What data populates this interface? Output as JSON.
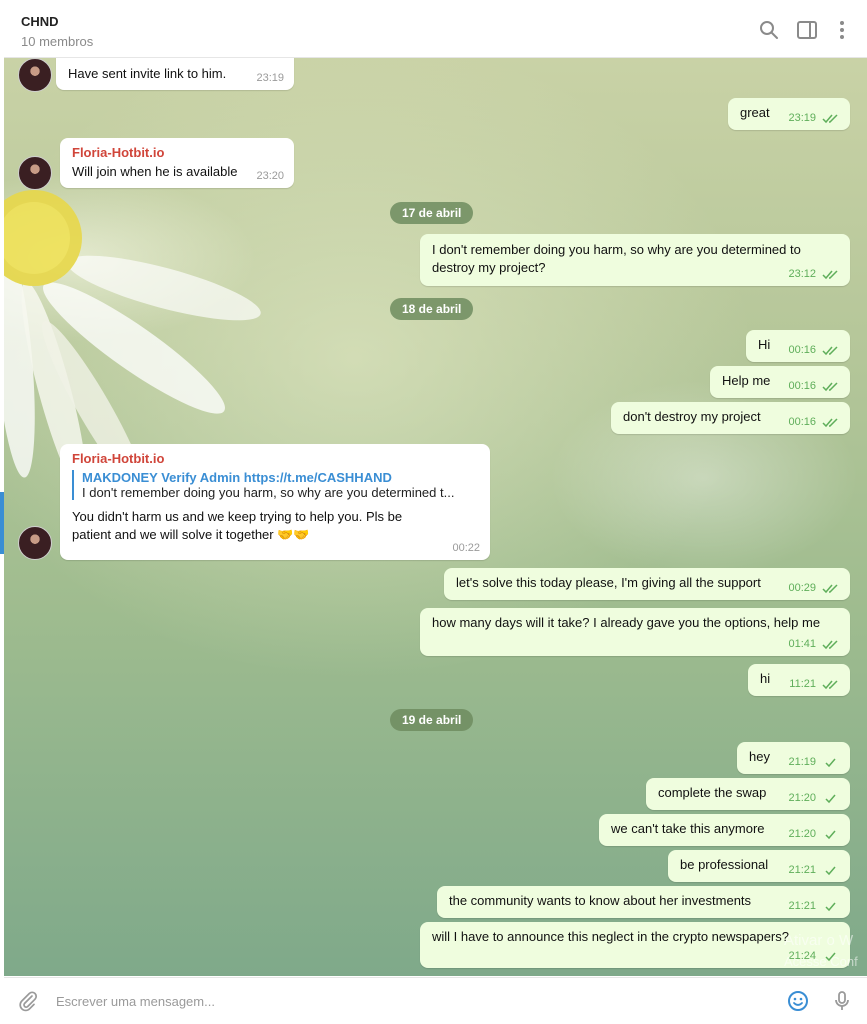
{
  "header": {
    "title": "CHND",
    "subtitle": "10 membros",
    "icons": [
      "search-icon",
      "sidebar-icon",
      "more-icon"
    ]
  },
  "dates": [
    "17 de abril",
    "18 de abril",
    "19 de abril"
  ],
  "messages": [
    {
      "dir": "in",
      "text": "Have sent invite link to him.",
      "time": "23:19"
    },
    {
      "dir": "out",
      "text": "great",
      "time": "23:19"
    },
    {
      "dir": "in",
      "sender": "Floria-Hotbit.io",
      "text": "Will join when he is available",
      "time": "23:20"
    },
    {
      "dir": "out",
      "text": "I don't remember doing you harm, so why are you determined to destroy my project?",
      "time": "23:12"
    },
    {
      "dir": "out",
      "text": "Hi",
      "time": "00:16"
    },
    {
      "dir": "out",
      "text": "Help me",
      "time": "00:16"
    },
    {
      "dir": "out",
      "text": "don't destroy my project",
      "time": "00:16"
    },
    {
      "dir": "in",
      "sender": "Floria-Hotbit.io",
      "reply_title": "MAKDONEY Verify Admin https://t.me/CASHHAND",
      "reply_text": "I don't remember doing you harm, so why are you determined t...",
      "text": "You didn't harm us and we keep trying to help you. Pls be patient and we will solve it together 🤝🤝",
      "time": "00:22"
    },
    {
      "dir": "out",
      "text": "let's solve this today please, I'm giving all the support",
      "time": "00:29"
    },
    {
      "dir": "out",
      "text": "how many days will it take? I already gave you the options, help me",
      "time": "01:41"
    },
    {
      "dir": "out",
      "text": "hi",
      "time": "11:21"
    },
    {
      "dir": "out",
      "text": "hey",
      "time": "21:19"
    },
    {
      "dir": "out",
      "text": "complete the swap",
      "time": "21:20"
    },
    {
      "dir": "out",
      "text": "we can't take this anymore",
      "time": "21:20"
    },
    {
      "dir": "out",
      "text": "be professional",
      "time": "21:21"
    },
    {
      "dir": "out",
      "text": "the community wants to know about her investments",
      "time": "21:21"
    },
    {
      "dir": "out",
      "text": "will I have to announce this neglect in the crypto newspapers?",
      "time": "21:24"
    }
  ],
  "watermark": {
    "line1": "Ativar o W",
    "line2": "Acesse Conf"
  },
  "composer": {
    "placeholder": "Escrever uma mensagem...",
    "icons": [
      "attach-icon",
      "emoji-icon",
      "microphone-icon"
    ]
  },
  "colors": {
    "outgoing_bubble": "#effdde",
    "sender_name": "#d0453a",
    "link": "#3a8ed4",
    "check": "#5fae5a"
  }
}
